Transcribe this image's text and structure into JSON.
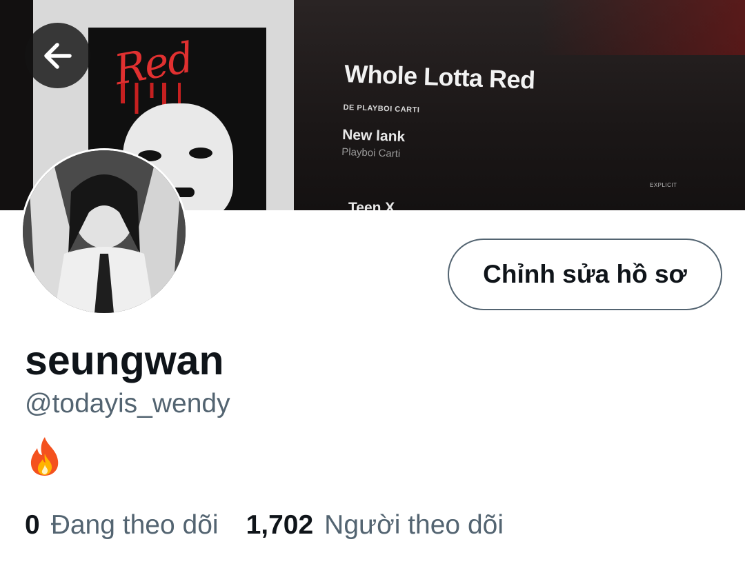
{
  "header": {
    "banner": {
      "album_title": "Whole Lotta Red",
      "album_artist": "DE PLAYBOI CARTI",
      "cover_word": "Red",
      "track_name": "New lank",
      "track_artist": "Playboi Carti",
      "explicit": "EXPLICIT",
      "next_track": "Teen X"
    }
  },
  "profile": {
    "edit_button": "Chỉnh sửa hồ sơ",
    "display_name": "seungwan",
    "handle": "@todayis_wendy",
    "bio_emoji": "fire-icon"
  },
  "stats": {
    "following_count": "0",
    "following_label": "Đang theo dõi",
    "followers_count": "1,702",
    "followers_label": "Người theo dõi"
  },
  "colors": {
    "text_primary": "#0f1419",
    "text_secondary": "#536471",
    "button_border": "#536471"
  }
}
